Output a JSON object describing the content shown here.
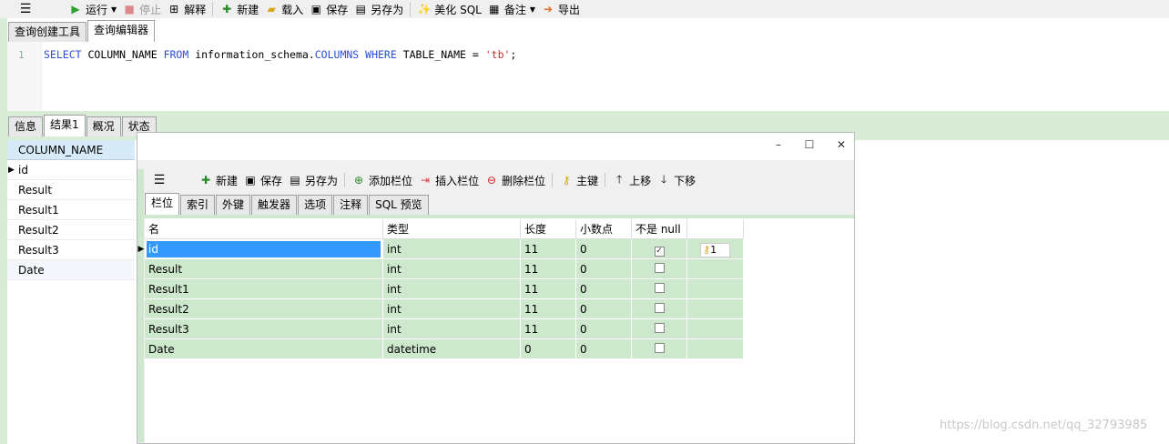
{
  "toolbar": {
    "run": "运行",
    "stop": "停止",
    "explain": "解释",
    "new": "新建",
    "load": "载入",
    "save": "保存",
    "save_as": "另存为",
    "beautify": "美化 SQL",
    "comment": "备注",
    "export": "导出"
  },
  "editor_tabs": [
    "查询创建工具",
    "查询编辑器"
  ],
  "editor": {
    "line_number": "1",
    "sql": {
      "kw_select": "SELECT",
      "col": " COLUMN_NAME ",
      "kw_from": "FROM",
      "schema": " information_schema.",
      "kw_columns": "COLUMNS",
      "sp": " ",
      "kw_where": "WHERE",
      "cond": " TABLE_NAME = ",
      "value": "'tb'",
      "end": ";"
    }
  },
  "result_tabs": [
    "信息",
    "结果1",
    "概况",
    "状态"
  ],
  "result_grid": {
    "header": "COLUMN_NAME",
    "rows": [
      "id",
      "Result",
      "Result1",
      "Result2",
      "Result3",
      "Date"
    ]
  },
  "dialog": {
    "controls": {
      "minimize": "–",
      "maximize": "☐",
      "close": "✕"
    },
    "toolbar": {
      "new": "新建",
      "save": "保存",
      "save_as": "另存为",
      "add_field": "添加栏位",
      "insert_field": "插入栏位",
      "delete_field": "删除栏位",
      "primary_key": "主键",
      "move_up": "上移",
      "move_down": "下移"
    },
    "tabs": [
      "栏位",
      "索引",
      "外键",
      "触发器",
      "选项",
      "注释",
      "SQL 预览"
    ],
    "columns": [
      "名",
      "类型",
      "长度",
      "小数点",
      "不是 null",
      ""
    ],
    "rows": [
      {
        "name": "id",
        "type": "int",
        "length": "11",
        "decimal": "0",
        "not_null": true,
        "key": "1"
      },
      {
        "name": "Result",
        "type": "int",
        "length": "11",
        "decimal": "0",
        "not_null": false,
        "key": ""
      },
      {
        "name": "Result1",
        "type": "int",
        "length": "11",
        "decimal": "0",
        "not_null": false,
        "key": ""
      },
      {
        "name": "Result2",
        "type": "int",
        "length": "11",
        "decimal": "0",
        "not_null": false,
        "key": ""
      },
      {
        "name": "Result3",
        "type": "int",
        "length": "11",
        "decimal": "0",
        "not_null": false,
        "key": ""
      },
      {
        "name": "Date",
        "type": "datetime",
        "length": "0",
        "decimal": "0",
        "not_null": false,
        "key": ""
      }
    ]
  },
  "watermark": "https://blog.csdn.net/qq_32793985",
  "colors": {
    "grid_green": "#cde8cd",
    "selected_cell": "#3399ff",
    "keyword_blue": "#2a4fd6",
    "string_red": "#c03030"
  }
}
